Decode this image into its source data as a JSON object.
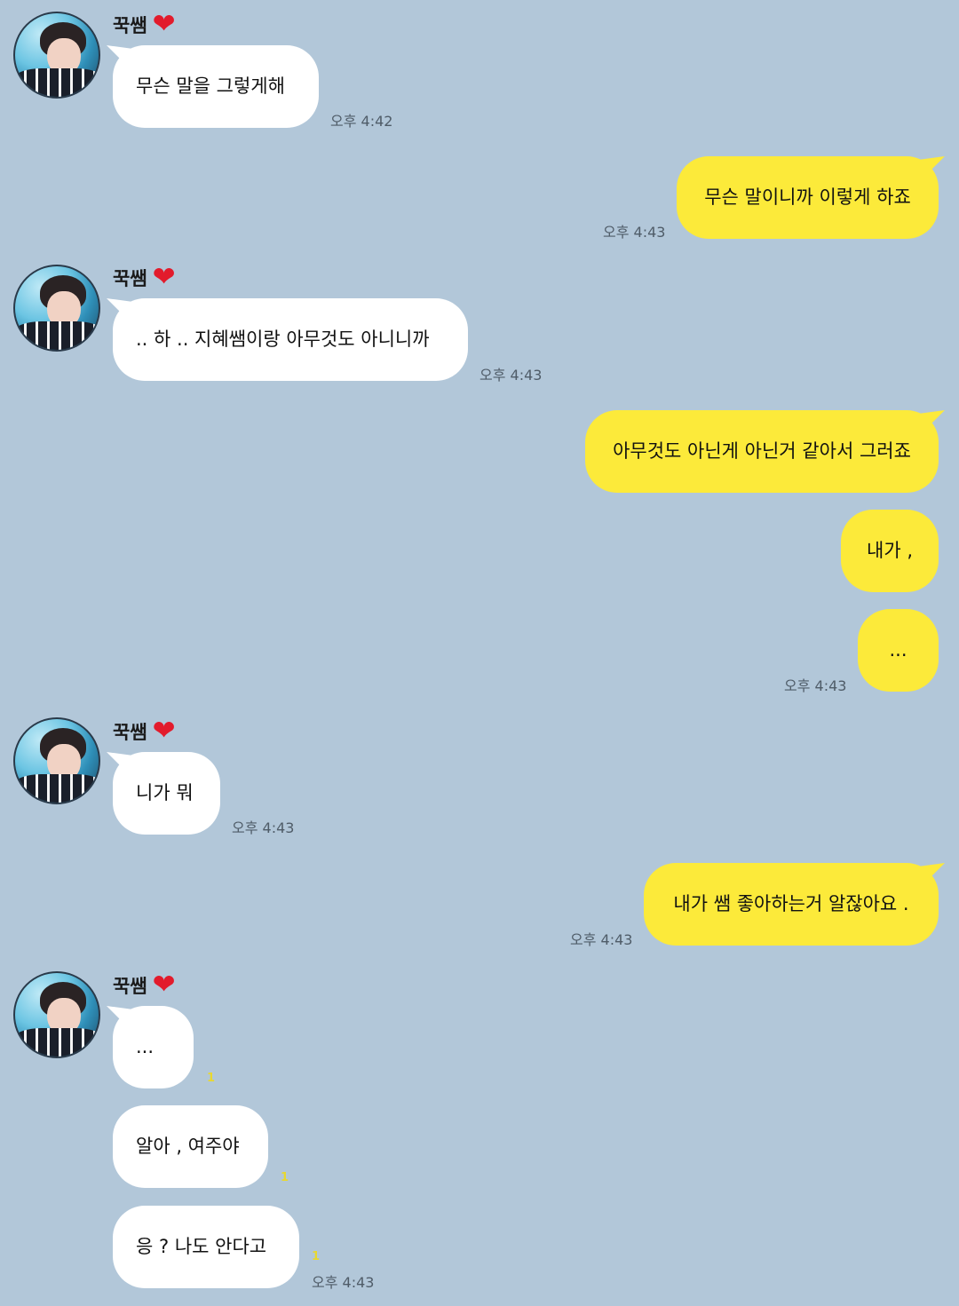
{
  "sender_name": "꾹쌤",
  "heart_icon": "❤",
  "colors": {
    "background": "#b2c7d9",
    "bubble_in": "#ffffff",
    "bubble_out": "#fcea3a",
    "heart": "#e21b2c"
  },
  "messages": [
    {
      "text": "무슨 말을 그렇게해",
      "time": "오후 4:42"
    },
    {
      "text": "무슨 말이니까 이렇게 하죠",
      "time": "오후 4:43"
    },
    {
      "text": ".. 하 .. 지혜쌤이랑 아무것도 아니니까",
      "time": "오후 4:43"
    },
    {
      "text": "아무것도 아닌게 아닌거 같아서 그러죠"
    },
    {
      "text": "내가 ,"
    },
    {
      "text": "...",
      "time": "오후 4:43"
    },
    {
      "text": "니가 뭐",
      "time": "오후 4:43"
    },
    {
      "text": "내가 쌤 좋아하는거 알잖아요 .",
      "time": "오후 4:43"
    },
    {
      "text": "...",
      "unread": "1"
    },
    {
      "text": "알아 , 여주야",
      "unread": "1"
    },
    {
      "text": "응 ? 나도 안다고",
      "unread": "1",
      "time": "오후 4:43"
    }
  ]
}
